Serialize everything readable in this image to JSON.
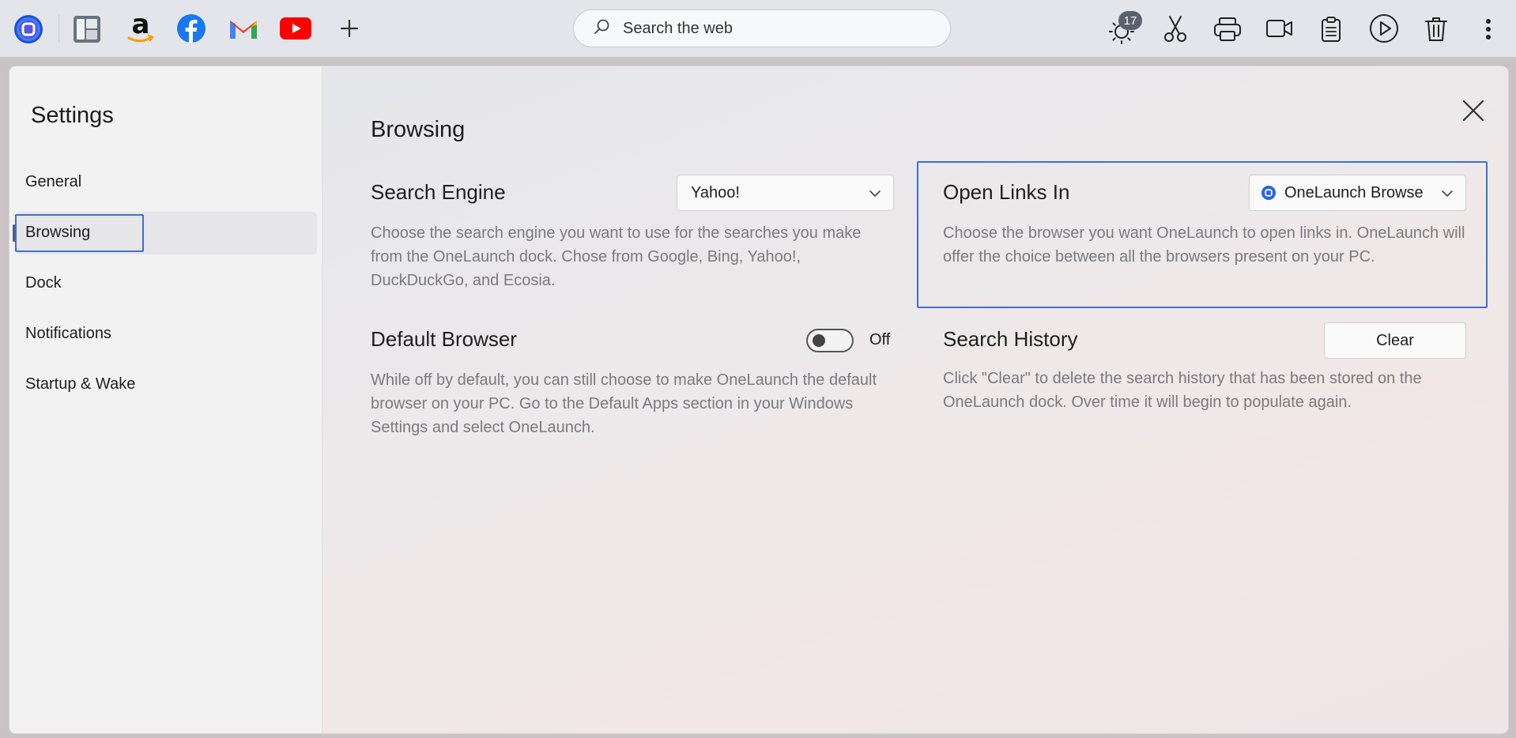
{
  "dock": {
    "apps": [
      {
        "name": "onelaunch",
        "icon": "onelaunch-icon"
      },
      {
        "name": "files",
        "icon": "folder-icon"
      },
      {
        "name": "amazon",
        "icon": "amazon-icon"
      },
      {
        "name": "facebook",
        "icon": "facebook-icon"
      },
      {
        "name": "gmail",
        "icon": "gmail-icon"
      },
      {
        "name": "youtube",
        "icon": "youtube-icon"
      },
      {
        "name": "add",
        "icon": "plus-icon"
      }
    ],
    "search": {
      "placeholder": "Search the web"
    },
    "weather_badge": "17",
    "tools": [
      "weather-icon",
      "scissors-icon",
      "printer-icon",
      "video-camera-icon",
      "clipboard-icon",
      "play-icon",
      "trash-icon",
      "more-icon"
    ]
  },
  "sidebar": {
    "title": "Settings",
    "items": [
      {
        "label": "General"
      },
      {
        "label": "Browsing"
      },
      {
        "label": "Dock"
      },
      {
        "label": "Notifications"
      },
      {
        "label": "Startup & Wake"
      }
    ],
    "active_index": 1
  },
  "main": {
    "title": "Browsing",
    "search_engine": {
      "title": "Search Engine",
      "selected": "Yahoo!",
      "description": "Choose the search engine you want to use for the searches you make from the OneLaunch dock. Chose from Google, Bing, Yahoo!, DuckDuckGo, and Ecosia."
    },
    "open_links": {
      "title": "Open Links In",
      "selected": "OneLaunch Browse",
      "description": "Choose the browser you want OneLaunch to open links in. OneLaunch will offer the choice between all the browsers present on your PC."
    },
    "default_browser": {
      "title": "Default Browser",
      "toggle_state": "Off",
      "description": "While off by default, you can still choose to make OneLaunch the default browser on your PC. Go to the Default Apps section in your Windows Settings and select OneLaunch."
    },
    "search_history": {
      "title": "Search History",
      "button": "Clear",
      "description": "Click \"Clear\" to delete the search history that has been stored on the OneLaunch dock. Over time it will begin to populate again."
    }
  },
  "colors": {
    "focus": "#3f6fd2",
    "dock_bg": "#e4e5ea",
    "sidebar_bg": "#f2f2f3",
    "desc_text": "#7a7a7f"
  }
}
